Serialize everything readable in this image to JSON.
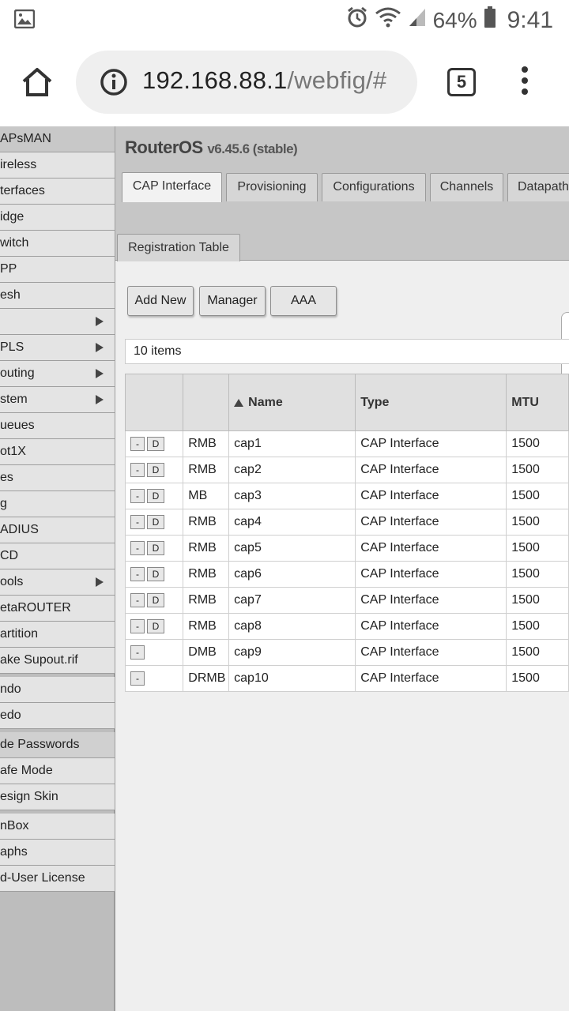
{
  "status_bar": {
    "battery_percent": "64%",
    "time": "9:41"
  },
  "browser": {
    "url_host": "192.168.88.1",
    "url_path": "/webfig/#",
    "tab_count": "5"
  },
  "sidebar": {
    "items": [
      {
        "label": "APsMAN",
        "arrow": false,
        "style": "head"
      },
      {
        "label": "ireless",
        "arrow": false
      },
      {
        "label": "terfaces",
        "arrow": false
      },
      {
        "label": "idge",
        "arrow": false
      },
      {
        "label": "witch",
        "arrow": false
      },
      {
        "label": "PP",
        "arrow": false
      },
      {
        "label": "esh",
        "arrow": false
      },
      {
        "label": "",
        "arrow": true
      },
      {
        "label": "PLS",
        "arrow": true
      },
      {
        "label": "outing",
        "arrow": true
      },
      {
        "label": "stem",
        "arrow": true
      },
      {
        "label": "ueues",
        "arrow": false
      },
      {
        "label": "ot1X",
        "arrow": false
      },
      {
        "label": "es",
        "arrow": false
      },
      {
        "label": "g",
        "arrow": false
      },
      {
        "label": "ADIUS",
        "arrow": false
      },
      {
        "label": "CD",
        "arrow": false
      },
      {
        "label": "ools",
        "arrow": true
      },
      {
        "label": "etaROUTER",
        "arrow": false
      },
      {
        "label": "artition",
        "arrow": false
      },
      {
        "label": "ake Supout.rif",
        "arrow": false
      },
      {
        "label": "ndo",
        "arrow": false
      },
      {
        "label": "edo",
        "arrow": false
      },
      {
        "label": "de Passwords",
        "arrow": false,
        "style": "dark"
      },
      {
        "label": "afe Mode",
        "arrow": false
      },
      {
        "label": "esign Skin",
        "arrow": false
      },
      {
        "label": "nBox",
        "arrow": false
      },
      {
        "label": "aphs",
        "arrow": false
      },
      {
        "label": "d-User License",
        "arrow": false
      }
    ]
  },
  "header": {
    "product": "RouterOS",
    "version": "v6.45.6 (stable)"
  },
  "tabs": [
    {
      "label": "CAP Interface",
      "active": true
    },
    {
      "label": "Provisioning",
      "active": false
    },
    {
      "label": "Configurations",
      "active": false
    },
    {
      "label": "Channels",
      "active": false
    },
    {
      "label": "Datapath",
      "active": false
    }
  ],
  "subtab": {
    "label": "Registration Table"
  },
  "toolbar": {
    "add_new": "Add New",
    "manager": "Manager",
    "aaa": "AAA"
  },
  "item_count": "10 items",
  "table": {
    "columns": [
      "",
      "",
      "Name",
      "Type",
      "MTU"
    ],
    "rows": [
      {
        "has_d": true,
        "flags": "RMB",
        "name": "cap1",
        "type": "CAP Interface",
        "mtu": "1500"
      },
      {
        "has_d": true,
        "flags": "RMB",
        "name": "cap2",
        "type": "CAP Interface",
        "mtu": "1500"
      },
      {
        "has_d": true,
        "flags": "MB",
        "name": "cap3",
        "type": "CAP Interface",
        "mtu": "1500"
      },
      {
        "has_d": true,
        "flags": "RMB",
        "name": "cap4",
        "type": "CAP Interface",
        "mtu": "1500"
      },
      {
        "has_d": true,
        "flags": "RMB",
        "name": "cap5",
        "type": "CAP Interface",
        "mtu": "1500"
      },
      {
        "has_d": true,
        "flags": "RMB",
        "name": "cap6",
        "type": "CAP Interface",
        "mtu": "1500"
      },
      {
        "has_d": true,
        "flags": "RMB",
        "name": "cap7",
        "type": "CAP Interface",
        "mtu": "1500"
      },
      {
        "has_d": true,
        "flags": "RMB",
        "name": "cap8",
        "type": "CAP Interface",
        "mtu": "1500"
      },
      {
        "has_d": false,
        "flags": "DMB",
        "name": "cap9",
        "type": "CAP Interface",
        "mtu": "1500"
      },
      {
        "has_d": false,
        "flags": "DRMB",
        "name": "cap10",
        "type": "CAP Interface",
        "mtu": "1500"
      }
    ],
    "remove_label": "-",
    "disable_label": "D"
  }
}
